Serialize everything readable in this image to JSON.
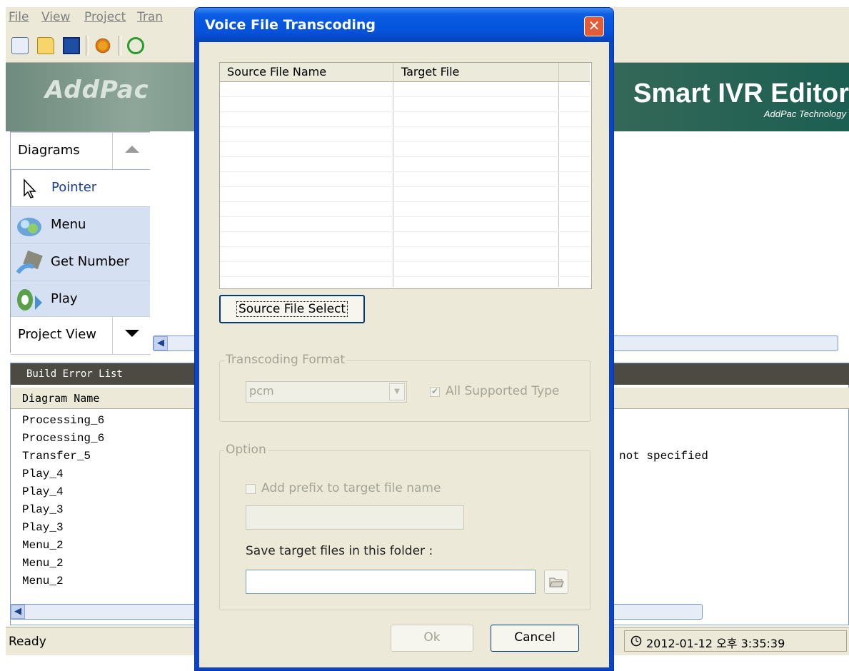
{
  "menu": {
    "items": [
      "File",
      "View",
      "Project",
      "Tran"
    ]
  },
  "banner": {
    "logo": "AddPac",
    "title": "Smart IVR Editor",
    "subtitle": "AddPac Technology"
  },
  "toolbox": {
    "header": "Diagrams",
    "items": [
      {
        "label": "Pointer",
        "icon": "pointer-icon"
      },
      {
        "label": "Menu",
        "icon": "menu-icon"
      },
      {
        "label": "Get Number",
        "icon": "get-number-icon"
      },
      {
        "label": "Play",
        "icon": "play-speaker-icon"
      }
    ],
    "footer": "Project View"
  },
  "build_errors": {
    "title": "Build Error List",
    "column": "Diagram Name",
    "rows": [
      "Processing_6",
      "Processing_6",
      "Transfer_5",
      "Play_4",
      "Play_4",
      "Play_3",
      "Play_3",
      "Menu_2",
      "Menu_2",
      "Menu_2"
    ],
    "partial_message": "not specified"
  },
  "status": {
    "ready": "Ready",
    "datetime": "2012-01-12 오후 3:35:39"
  },
  "dialog": {
    "title": "Voice File Transcoding",
    "columns": [
      "Source File Name",
      "Target File"
    ],
    "source_button": "Source File Select",
    "format_group": "Transcoding Format",
    "format_value": "pcm",
    "all_supported": "All Supported Type",
    "option_group": "Option",
    "prefix_label": "Add prefix to target file name",
    "prefix_value": "",
    "save_folder_label": "Save target files in this folder :",
    "save_folder_value": "",
    "ok": "Ok",
    "cancel": "Cancel"
  }
}
